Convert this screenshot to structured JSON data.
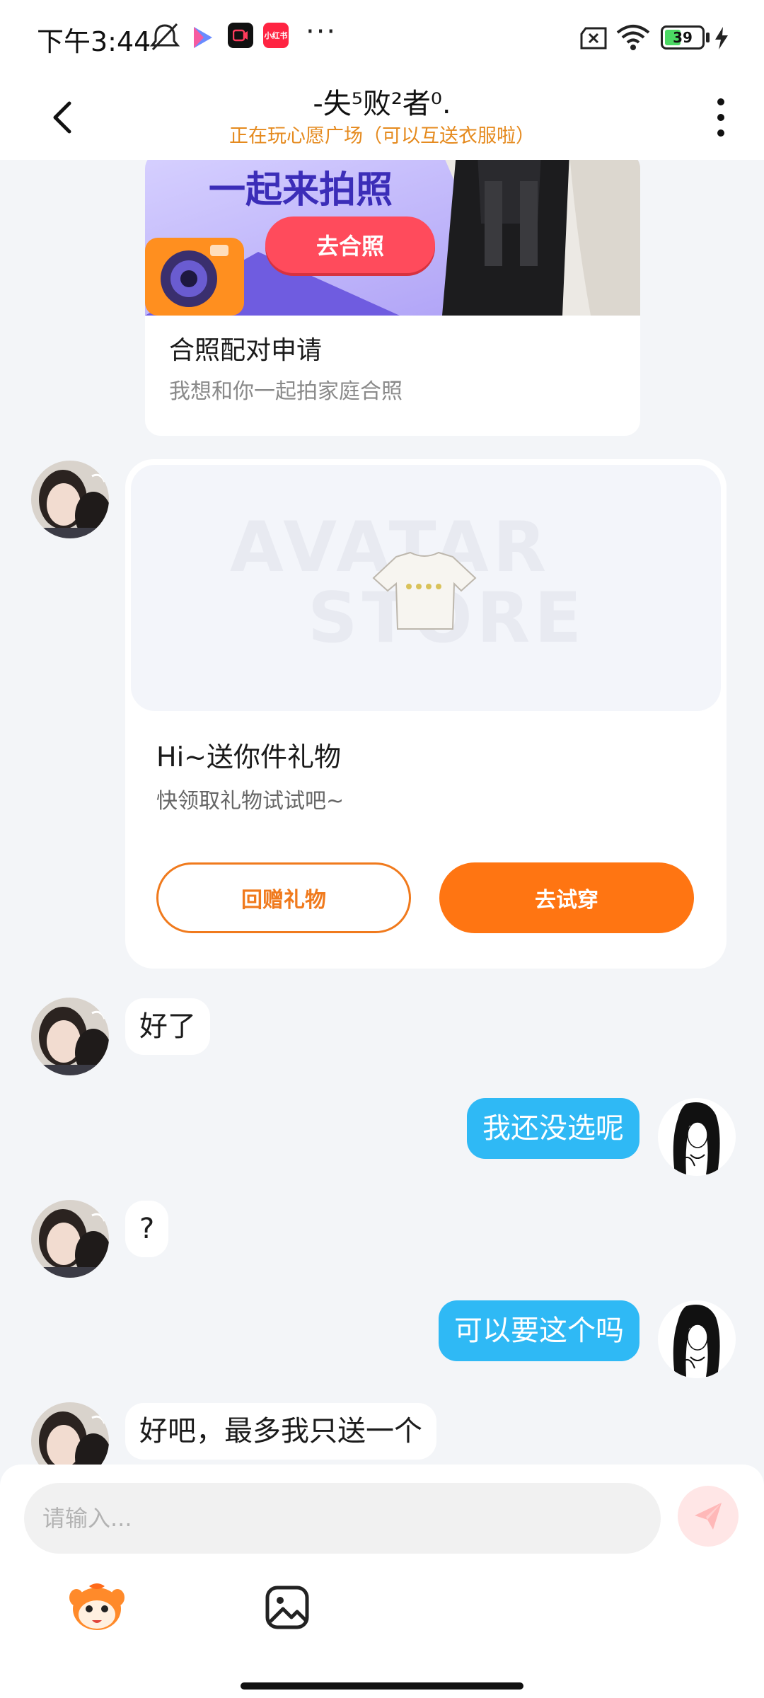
{
  "status_bar": {
    "time": "下午3:44",
    "battery_level": "39",
    "app_badges": [
      "小红书"
    ]
  },
  "header": {
    "title": "-失⁵败²者⁰.",
    "subtitle": "正在玩心愿广场（可以互送衣服啦）"
  },
  "photo_card": {
    "banner_text": "一起来拍照",
    "banner_button": "去合照",
    "title": "合照配对申请",
    "desc": "我想和你一起拍家庭合照"
  },
  "gift_card": {
    "watermark_line1": "AVATAR",
    "watermark_line2": "STORE",
    "title": "Hi~送你件礼物",
    "desc": "快领取礼物试试吧~",
    "return_gift_label": "回赠礼物",
    "try_on_label": "去试穿"
  },
  "messages": [
    {
      "side": "in",
      "text": "好了"
    },
    {
      "side": "out",
      "text": "我还没选呢"
    },
    {
      "side": "in",
      "text": "?"
    },
    {
      "side": "out",
      "text": "可以要这个吗"
    },
    {
      "side": "in",
      "text": "好吧，最多我只送一个"
    }
  ],
  "input": {
    "placeholder": "请输入..."
  },
  "colors": {
    "accent_orange": "#ff7512",
    "bubble_blue": "#2fb9f5",
    "subtitle_orange": "#e58a1e"
  }
}
